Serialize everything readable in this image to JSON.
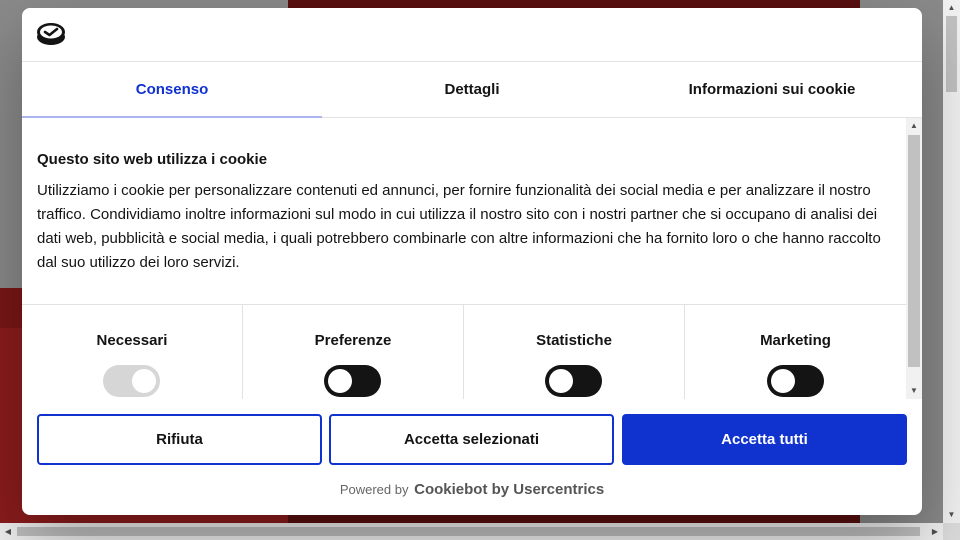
{
  "colors": {
    "accent": "#1032cf",
    "text": "#141414",
    "toggle_on": "#141414",
    "toggle_disabled": "#d6d6d6"
  },
  "header": {
    "logo_icon": "cookiebot-logo-icon"
  },
  "tabs": [
    {
      "label": "Consenso",
      "active": true
    },
    {
      "label": "Dettagli",
      "active": false
    },
    {
      "label": "Informazioni sui cookie",
      "active": false
    }
  ],
  "intro": {
    "title": "Questo sito web utilizza i cookie",
    "text": "Utilizziamo i cookie per personalizzare contenuti ed annunci, per fornire funzionalità dei social media e per analizzare il nostro traffico. Condividiamo inoltre informazioni sul modo in cui utilizza il nostro sito con i nostri partner che si occupano di analisi dei dati web, pubblicità e social media, i quali potrebbero combinarle con altre informazioni che ha fornito loro o che hanno raccolto dal suo utilizzo dei loro servizi."
  },
  "categories": [
    {
      "label": "Necessari",
      "state": "disabled"
    },
    {
      "label": "Preferenze",
      "state": "off"
    },
    {
      "label": "Statistiche",
      "state": "off"
    },
    {
      "label": "Marketing",
      "state": "off"
    }
  ],
  "buttons": {
    "reject": "Rifiuta",
    "accept_selected": "Accetta selezionati",
    "accept_all": "Accetta tutti"
  },
  "footer": {
    "powered_by": "Powered by",
    "brand": "Cookiebot by Usercentrics"
  }
}
